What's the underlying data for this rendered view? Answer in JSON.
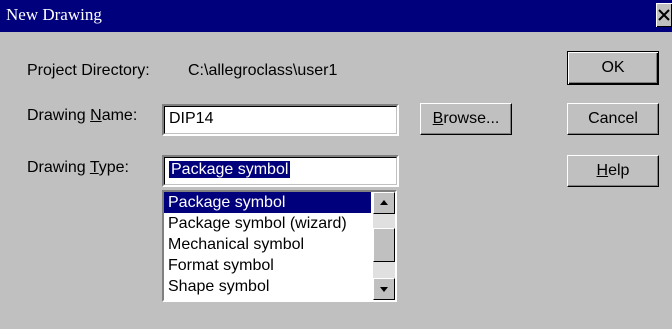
{
  "window": {
    "title": "New Drawing",
    "close_symbol": "×"
  },
  "project_directory": {
    "label": "Project Directory:",
    "value": "C:\\allegroclass\\user1"
  },
  "drawing_name": {
    "label_prefix": "Drawing ",
    "label_mnemonic": "N",
    "label_suffix": "ame:",
    "value": "DIP14"
  },
  "drawing_type": {
    "label_prefix": "Drawing ",
    "label_mnemonic": "T",
    "label_suffix": "ype:",
    "value": "Package symbol",
    "options": [
      "Package symbol",
      "Package symbol (wizard)",
      "Mechanical symbol",
      "Format symbol",
      "Shape symbol"
    ],
    "selected_index": 0
  },
  "buttons": {
    "browse_mnemonic": "B",
    "browse_rest": "rowse...",
    "ok": "OK",
    "cancel": "Cancel",
    "help_mnemonic": "H",
    "help_rest": "elp"
  },
  "icons": {
    "close": "close-icon",
    "scroll_up": "arrow-up-icon",
    "scroll_down": "arrow-down-icon"
  },
  "colors": {
    "titlebar": "#00007c",
    "dialog_bg": "#c0c0c0",
    "selection": "#00007c"
  }
}
